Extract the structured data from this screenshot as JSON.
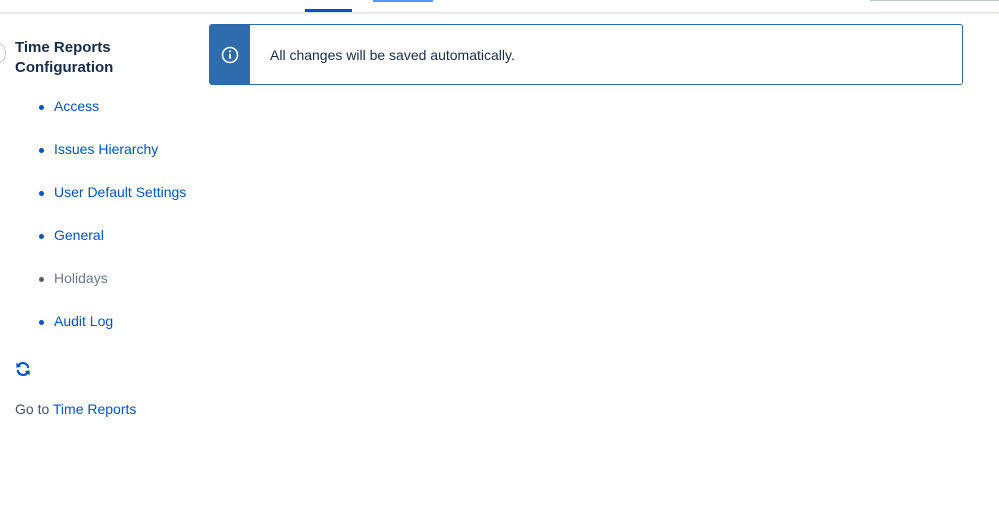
{
  "sidebar": {
    "title": "Time Reports Configuration",
    "items": [
      {
        "label": "Access",
        "enabled": true
      },
      {
        "label": "Issues Hierarchy",
        "enabled": true
      },
      {
        "label": "User Default Settings",
        "enabled": true
      },
      {
        "label": "General",
        "enabled": true
      },
      {
        "label": "Holidays",
        "enabled": false
      },
      {
        "label": "Audit Log",
        "enabled": true
      }
    ],
    "goto_prefix": "Go to",
    "goto_link": "Time Reports"
  },
  "banner": {
    "message": "All changes will be saved automatically.",
    "icon": "info-icon"
  },
  "colors": {
    "accent": "#0052cc",
    "banner_icon_bg": "#2f6cae"
  }
}
